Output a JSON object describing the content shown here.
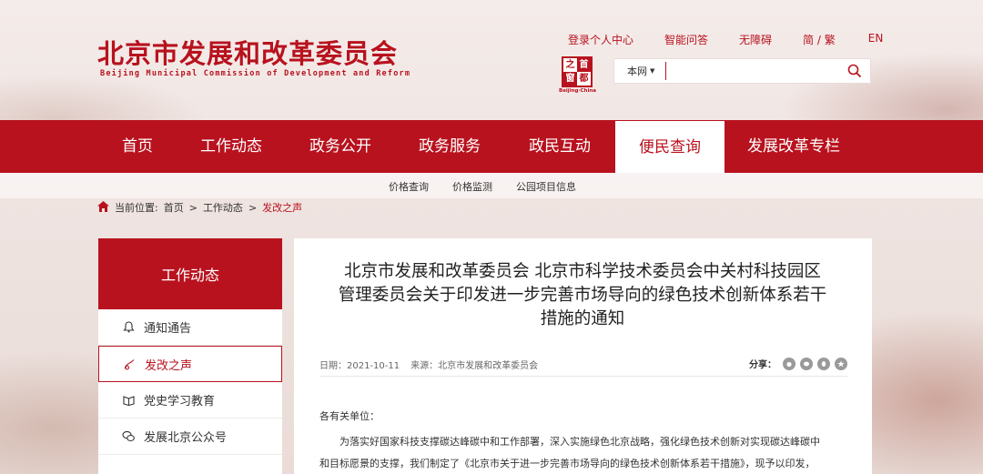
{
  "header": {
    "logo_cn": "北京市发展和改革委员会",
    "logo_en": "Beijing Municipal Commission of Development and Reform",
    "top_links": [
      "登录个人中心",
      "智能问答",
      "无障碍",
      "简 / 繁",
      "EN"
    ],
    "seal": {
      "chars": [
        "之",
        "首",
        "窗",
        "都"
      ],
      "caption": "Beijing·China"
    },
    "search": {
      "scope": "本网",
      "value": ""
    }
  },
  "nav": {
    "items": [
      "首页",
      "工作动态",
      "政务公开",
      "政务服务",
      "政民互动",
      "便民查询",
      "发展改革专栏"
    ],
    "active": "便民查询"
  },
  "subnav": {
    "items": [
      "价格查询",
      "价格监测",
      "公园项目信息"
    ]
  },
  "breadcrumb": {
    "prefix": "当前位置:",
    "items": [
      "首页",
      "工作动态",
      "发改之声"
    ],
    "sep": ">"
  },
  "sidebar": {
    "heading": "工作动态",
    "items": [
      {
        "label": "通知通告",
        "icon": "bell-icon"
      },
      {
        "label": "发改之声",
        "icon": "trumpet-icon",
        "active": true
      },
      {
        "label": "党史学习教育",
        "icon": "book-icon"
      },
      {
        "label": "发展北京公众号",
        "icon": "wechat-icon"
      }
    ]
  },
  "article": {
    "title_lines": [
      "北京市发展和改革委员会 北京市科学技术委员会中关村科技园区",
      "管理委员会关于印发进一步完善市场导向的绿色技术创新体系若干",
      "措施的通知"
    ],
    "date": "日期：2021-10-11",
    "source": "来源：北京市发展和改革委员会",
    "share_label": "分享：",
    "share_icons": [
      "weibo-icon",
      "wechat-share-icon",
      "qq-icon",
      "qzone-icon"
    ],
    "salutation": "各有关单位：",
    "para_lines": [
      "为落实好国家科技支撑碳达峰碳中和工作部署，深入实施绿色北京战略，强化绿色技术创新对实现碳达峰碳中",
      "和目标愿景的支撑，我们制定了《北京市关于进一步完善市场导向的绿色技术创新体系若干措施》，现予以印发，"
    ]
  },
  "colors": {
    "brand": "#b8121e",
    "nav_text": "#ffffff"
  }
}
